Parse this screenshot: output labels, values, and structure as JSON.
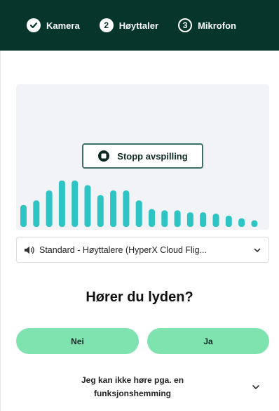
{
  "steps": [
    {
      "label": "Kamera",
      "badge": "",
      "state": "done"
    },
    {
      "label": "Høyttaler",
      "badge": "2",
      "state": "active"
    },
    {
      "label": "Mikrofon",
      "badge": "3",
      "state": "upcoming"
    }
  ],
  "player": {
    "stop_label": "Stopp avspilling",
    "levels": [
      0.33,
      0.4,
      0.55,
      0.7,
      0.7,
      0.63,
      0.48,
      0.55,
      0.55,
      0.4,
      0.27,
      0.25,
      0.25,
      0.22,
      0.22,
      0.2,
      0.17,
      0.13,
      0.1
    ],
    "bar_color": "#2ec4c4"
  },
  "device": {
    "label": "Standard - Høyttalere (HyperX Cloud Flig..."
  },
  "question": "Hører du lyden?",
  "answers": {
    "no": "Nei",
    "yes": "Ja"
  },
  "disability": {
    "line1": "Jeg kan ikke høre pga. en",
    "line2": "funksjonshemming"
  },
  "colors": {
    "header_bg": "#06352b",
    "answer_bg": "#7fe3b0",
    "player_bg": "#f1f3f7"
  }
}
